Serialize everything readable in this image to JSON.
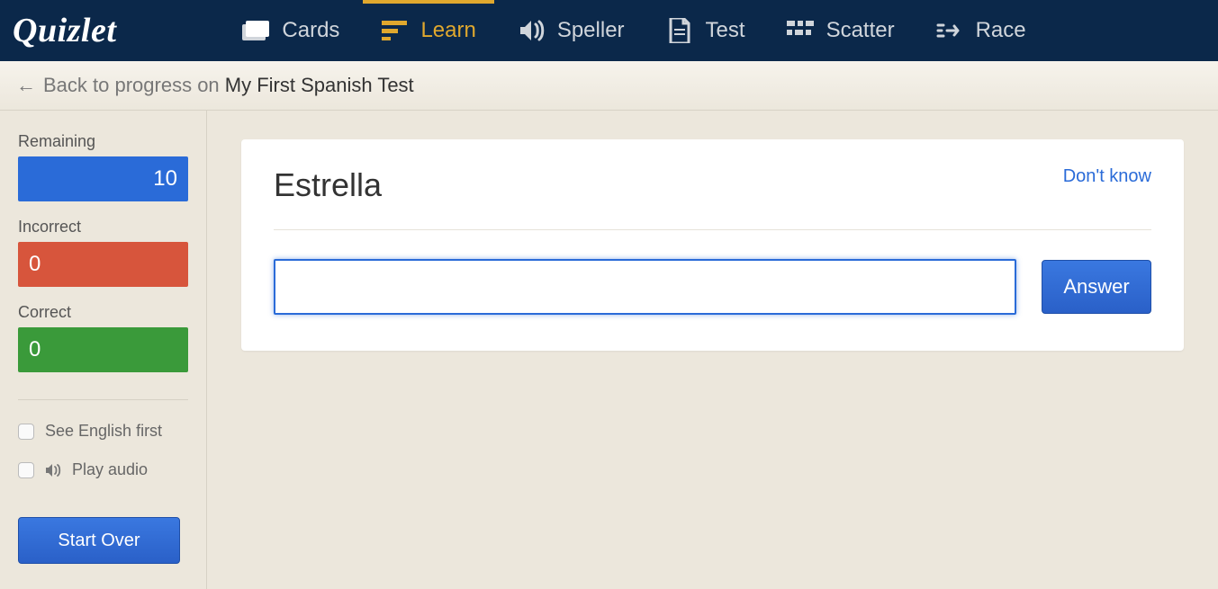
{
  "nav": {
    "logo": "Quizlet",
    "items": [
      {
        "label": "Cards"
      },
      {
        "label": "Learn"
      },
      {
        "label": "Speller"
      },
      {
        "label": "Test"
      },
      {
        "label": "Scatter"
      },
      {
        "label": "Race"
      }
    ]
  },
  "subheader": {
    "back_prefix": "Back to progress on ",
    "set_name": "My First Spanish Test"
  },
  "sidebar": {
    "remaining_label": "Remaining",
    "remaining_value": "10",
    "incorrect_label": "Incorrect",
    "incorrect_value": "0",
    "correct_label": "Correct",
    "correct_value": "0",
    "opt_english": "See English first",
    "opt_audio": "Play audio",
    "start_over": "Start Over"
  },
  "card": {
    "prompt": "Estrella",
    "dont_know": "Don't know",
    "answer_value": "",
    "answer_btn": "Answer"
  }
}
